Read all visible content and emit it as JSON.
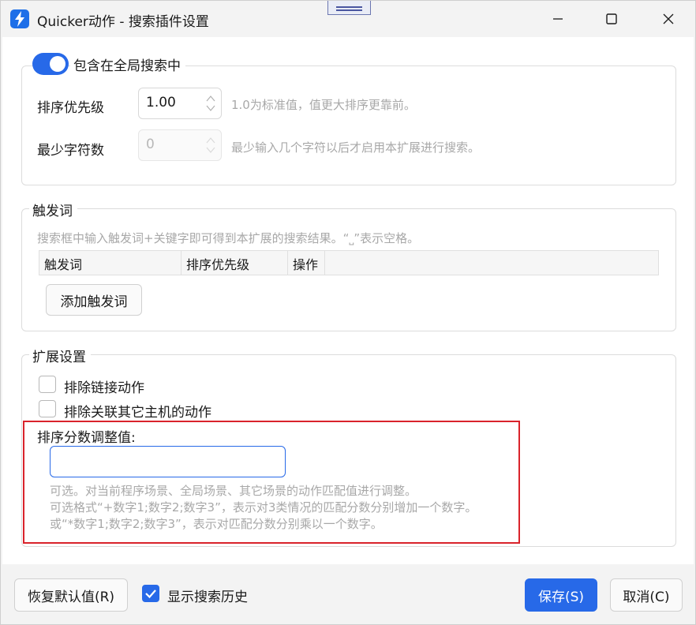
{
  "window": {
    "title": "Quicker动作 - 搜索插件设置"
  },
  "global_search": {
    "toggle_label": "包含在全局搜索中",
    "enabled": true,
    "priority_label": "排序优先级",
    "priority_value": "1.00",
    "priority_hint": "1.0为标准值，值更大排序更靠前。",
    "min_chars_label": "最少字符数",
    "min_chars_value": "0",
    "min_chars_hint": "最少输入几个字符以后才启用本扩展进行搜索。"
  },
  "triggers": {
    "legend": "触发词",
    "hint": "搜索框中输入触发词+关键字即可得到本扩展的搜索结果。“⎵”表示空格。",
    "columns": [
      "触发词",
      "排序优先级",
      "操作"
    ],
    "add_button": "添加触发词"
  },
  "extension": {
    "legend": "扩展设置",
    "exclude_link_label": "排除链接动作",
    "exclude_link_checked": false,
    "exclude_other_host_label": "排除关联其它主机的动作",
    "exclude_other_host_checked": false,
    "adjust_label": "排序分数调整值:",
    "adjust_value": "",
    "adjust_hint_1": "可选。对当前程序场景、全局场景、其它场景的动作匹配值进行调整。",
    "adjust_hint_2": "可选格式“+数字1;数字2;数字3”，表示对3类情况的匹配分数分别增加一个数字。",
    "adjust_hint_3": "或“*数字1;数字2;数字3”，表示对匹配分数分别乘以一个数字。"
  },
  "footer": {
    "reset_button": "恢复默认值(R)",
    "show_history_label": "显示搜索历史",
    "show_history_checked": true,
    "save_button": "保存(S)",
    "cancel_button": "取消(C)"
  },
  "colors": {
    "accent": "#2769e8",
    "highlight_border": "#d9232b"
  }
}
